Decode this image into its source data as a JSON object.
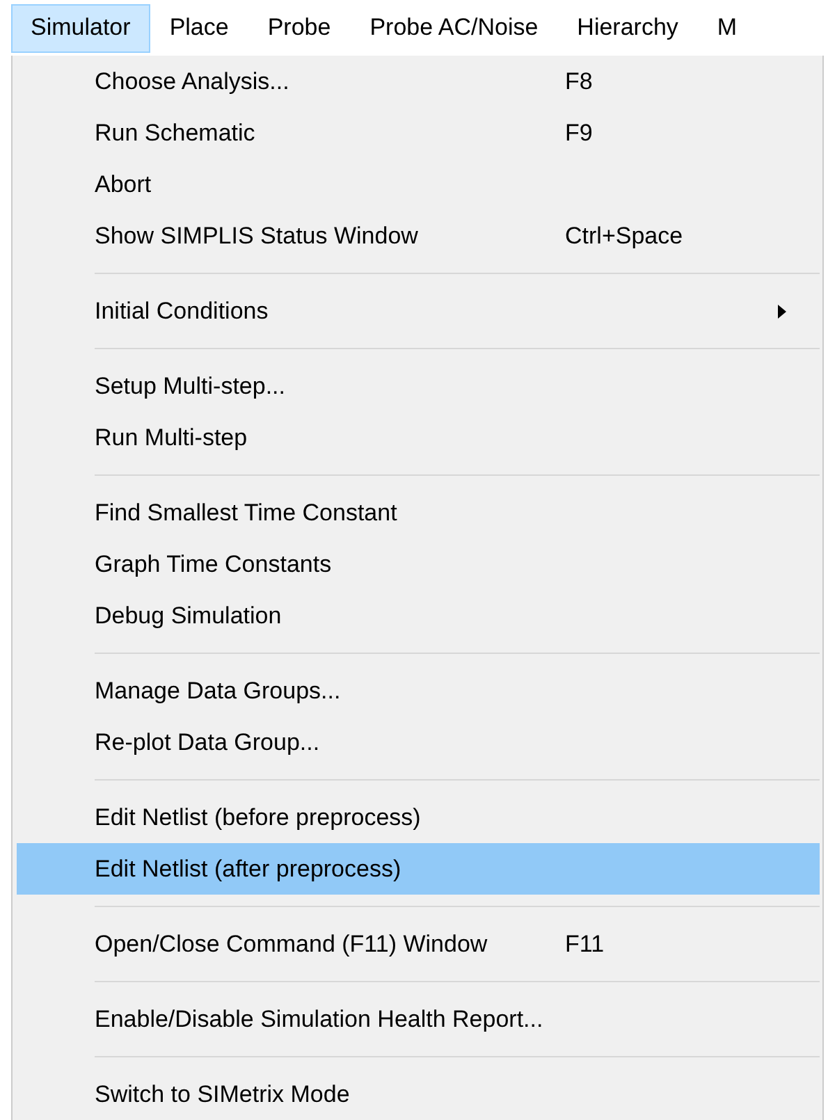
{
  "menubar": [
    {
      "label": "Simulator",
      "selected": true
    },
    {
      "label": "Place",
      "selected": false
    },
    {
      "label": "Probe",
      "selected": false
    },
    {
      "label": "Probe AC/Noise",
      "selected": false
    },
    {
      "label": "Hierarchy",
      "selected": false
    },
    {
      "label": "M",
      "selected": false
    }
  ],
  "menu": [
    {
      "kind": "item",
      "label": "Choose Analysis...",
      "shortcut": "F8",
      "selected": false
    },
    {
      "kind": "item",
      "label": "Run Schematic",
      "shortcut": "F9",
      "selected": false
    },
    {
      "kind": "item",
      "label": "Abort",
      "selected": false
    },
    {
      "kind": "item",
      "label": "Show SIMPLIS Status Window",
      "shortcut": "Ctrl+Space",
      "selected": false
    },
    {
      "kind": "separator"
    },
    {
      "kind": "submenu",
      "label": "Initial Conditions",
      "selected": false
    },
    {
      "kind": "separator"
    },
    {
      "kind": "item",
      "label": "Setup Multi-step...",
      "selected": false
    },
    {
      "kind": "item",
      "label": "Run Multi-step",
      "selected": false
    },
    {
      "kind": "separator"
    },
    {
      "kind": "item",
      "label": "Find Smallest Time Constant",
      "selected": false
    },
    {
      "kind": "item",
      "label": "Graph Time Constants",
      "selected": false
    },
    {
      "kind": "item",
      "label": "Debug Simulation",
      "selected": false
    },
    {
      "kind": "separator"
    },
    {
      "kind": "item",
      "label": "Manage Data Groups...",
      "selected": false
    },
    {
      "kind": "item",
      "label": "Re-plot Data Group...",
      "selected": false
    },
    {
      "kind": "separator"
    },
    {
      "kind": "item",
      "label": "Edit Netlist (before preprocess)",
      "selected": false
    },
    {
      "kind": "item",
      "label": "Edit Netlist (after preprocess)",
      "selected": true
    },
    {
      "kind": "separator"
    },
    {
      "kind": "item",
      "label": "Open/Close Command (F11) Window",
      "shortcut": "F11",
      "selected": false
    },
    {
      "kind": "separator"
    },
    {
      "kind": "item",
      "label": "Enable/Disable Simulation Health Report...",
      "selected": false
    },
    {
      "kind": "separator"
    },
    {
      "kind": "item",
      "label": "Switch to SIMetrix Mode",
      "selected": false
    }
  ]
}
